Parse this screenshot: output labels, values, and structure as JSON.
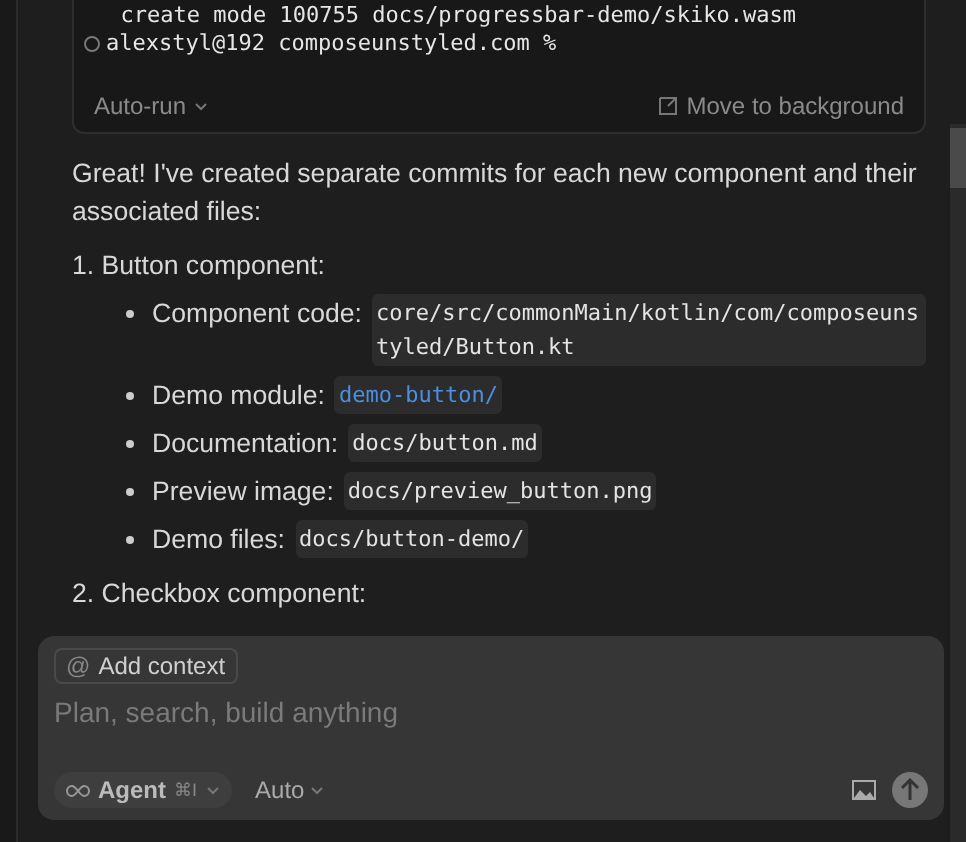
{
  "terminal": {
    "lines": [
      "  create mode 100755 docs/progressbar-demo/skiko.wasm"
    ],
    "prompt": "alexstyl@192 composeunstyled.com %",
    "auto_run": "Auto-run",
    "move_button": "Move to background"
  },
  "message": {
    "intro": "Great! I've created separate commits for each new component and their associated files:",
    "sections": [
      {
        "number": "1.",
        "title": "Button component:",
        "items": [
          {
            "label": "Component code:",
            "value": "core/src/commonMain/kotlin/com/composeunstyled/Button.kt",
            "kind": "code"
          },
          {
            "label": "Demo module:",
            "value": "demo-button/",
            "kind": "link"
          },
          {
            "label": "Documentation:",
            "value": "docs/button.md",
            "kind": "code"
          },
          {
            "label": "Preview image:",
            "value": "docs/preview_button.png",
            "kind": "code"
          },
          {
            "label": "Demo files:",
            "value": "docs/button-demo/",
            "kind": "code"
          }
        ]
      },
      {
        "number": "2.",
        "title": "Checkbox component:"
      }
    ]
  },
  "composer": {
    "context_icon": "@",
    "context_button": "Add context",
    "placeholder": "Plan, search, build anything",
    "mode": "Agent",
    "shortcut": "⌘I",
    "model": "Auto"
  }
}
